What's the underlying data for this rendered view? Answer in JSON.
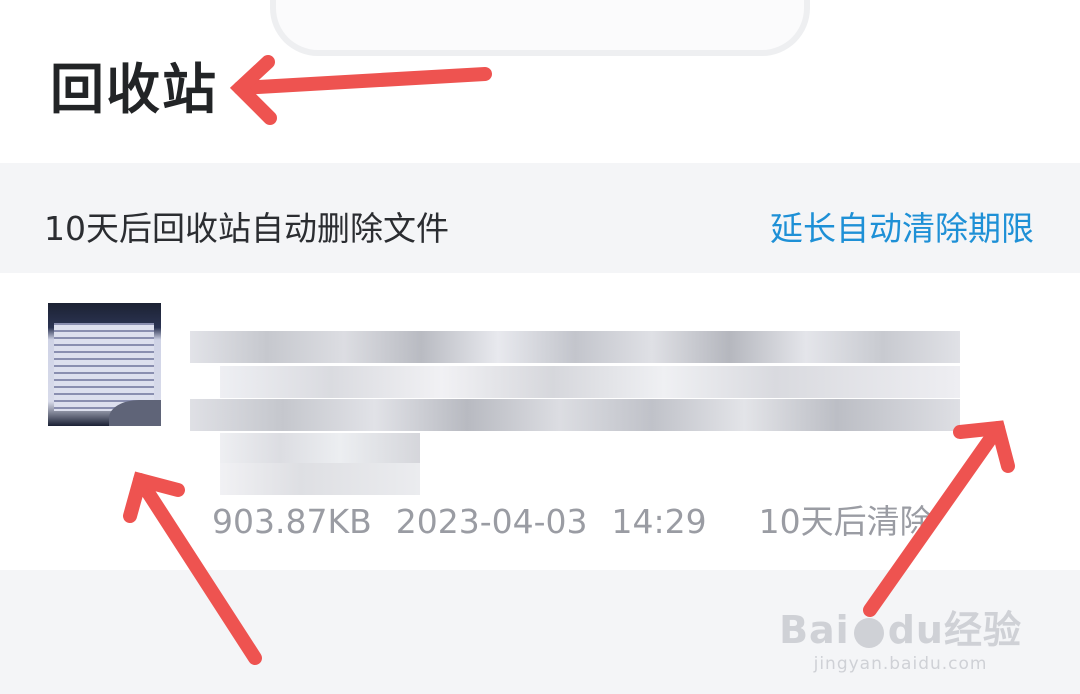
{
  "header": {
    "title": "回收站"
  },
  "notice": {
    "text": "10天后回收站自动删除文件",
    "extend_link": "延长自动清除期限"
  },
  "file": {
    "size": "903.87KB",
    "date": "2023-04-03",
    "time": "14:29",
    "expiry": "10天后清除"
  },
  "watermark": {
    "brand_left": "Bai",
    "brand_mid": "du",
    "brand_right": "经验",
    "url": "jingyan.baidu.com"
  },
  "colors": {
    "accent": "#1e90d6",
    "annotation": "#ee5350"
  }
}
